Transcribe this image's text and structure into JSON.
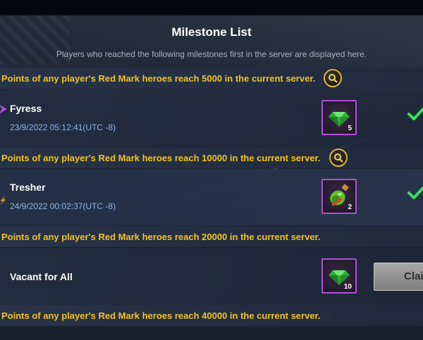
{
  "title": "Milestone List",
  "subtitle": "Players who reached the following milestones first in the server are displayed here.",
  "milestones": [
    {
      "text": "Points of any player's Red Mark heroes reach 5000 in the current server."
    },
    {
      "text": "Points of any player's Red Mark heroes reach 10000 in the current server."
    },
    {
      "text": "Points of any player's Red Mark heroes reach 20000 in the current server."
    },
    {
      "text": "Points of any player's Red Mark heroes reach 40000 in the current server."
    }
  ],
  "rows": [
    {
      "player": "Fyress",
      "time": "23/9/2022 05:12:41(UTC -8)",
      "reward_icon": "green-gem-icon",
      "reward_count": "5",
      "status": "claimed"
    },
    {
      "player": "Tresher",
      "time": "24/9/2022 00:02:37(UTC -8)",
      "reward_icon": "green-potion-icon",
      "reward_count": "2",
      "status": "claimed"
    },
    {
      "player": "Vacant for All",
      "reward_icon": "green-gem-icon",
      "reward_count": "10",
      "button_label": "Clai"
    }
  ],
  "colors": {
    "milestone_text": "#f3c128",
    "timestamp_text": "#8fb6e8",
    "check": "#39e05a",
    "item_border": "#b24fd8"
  }
}
